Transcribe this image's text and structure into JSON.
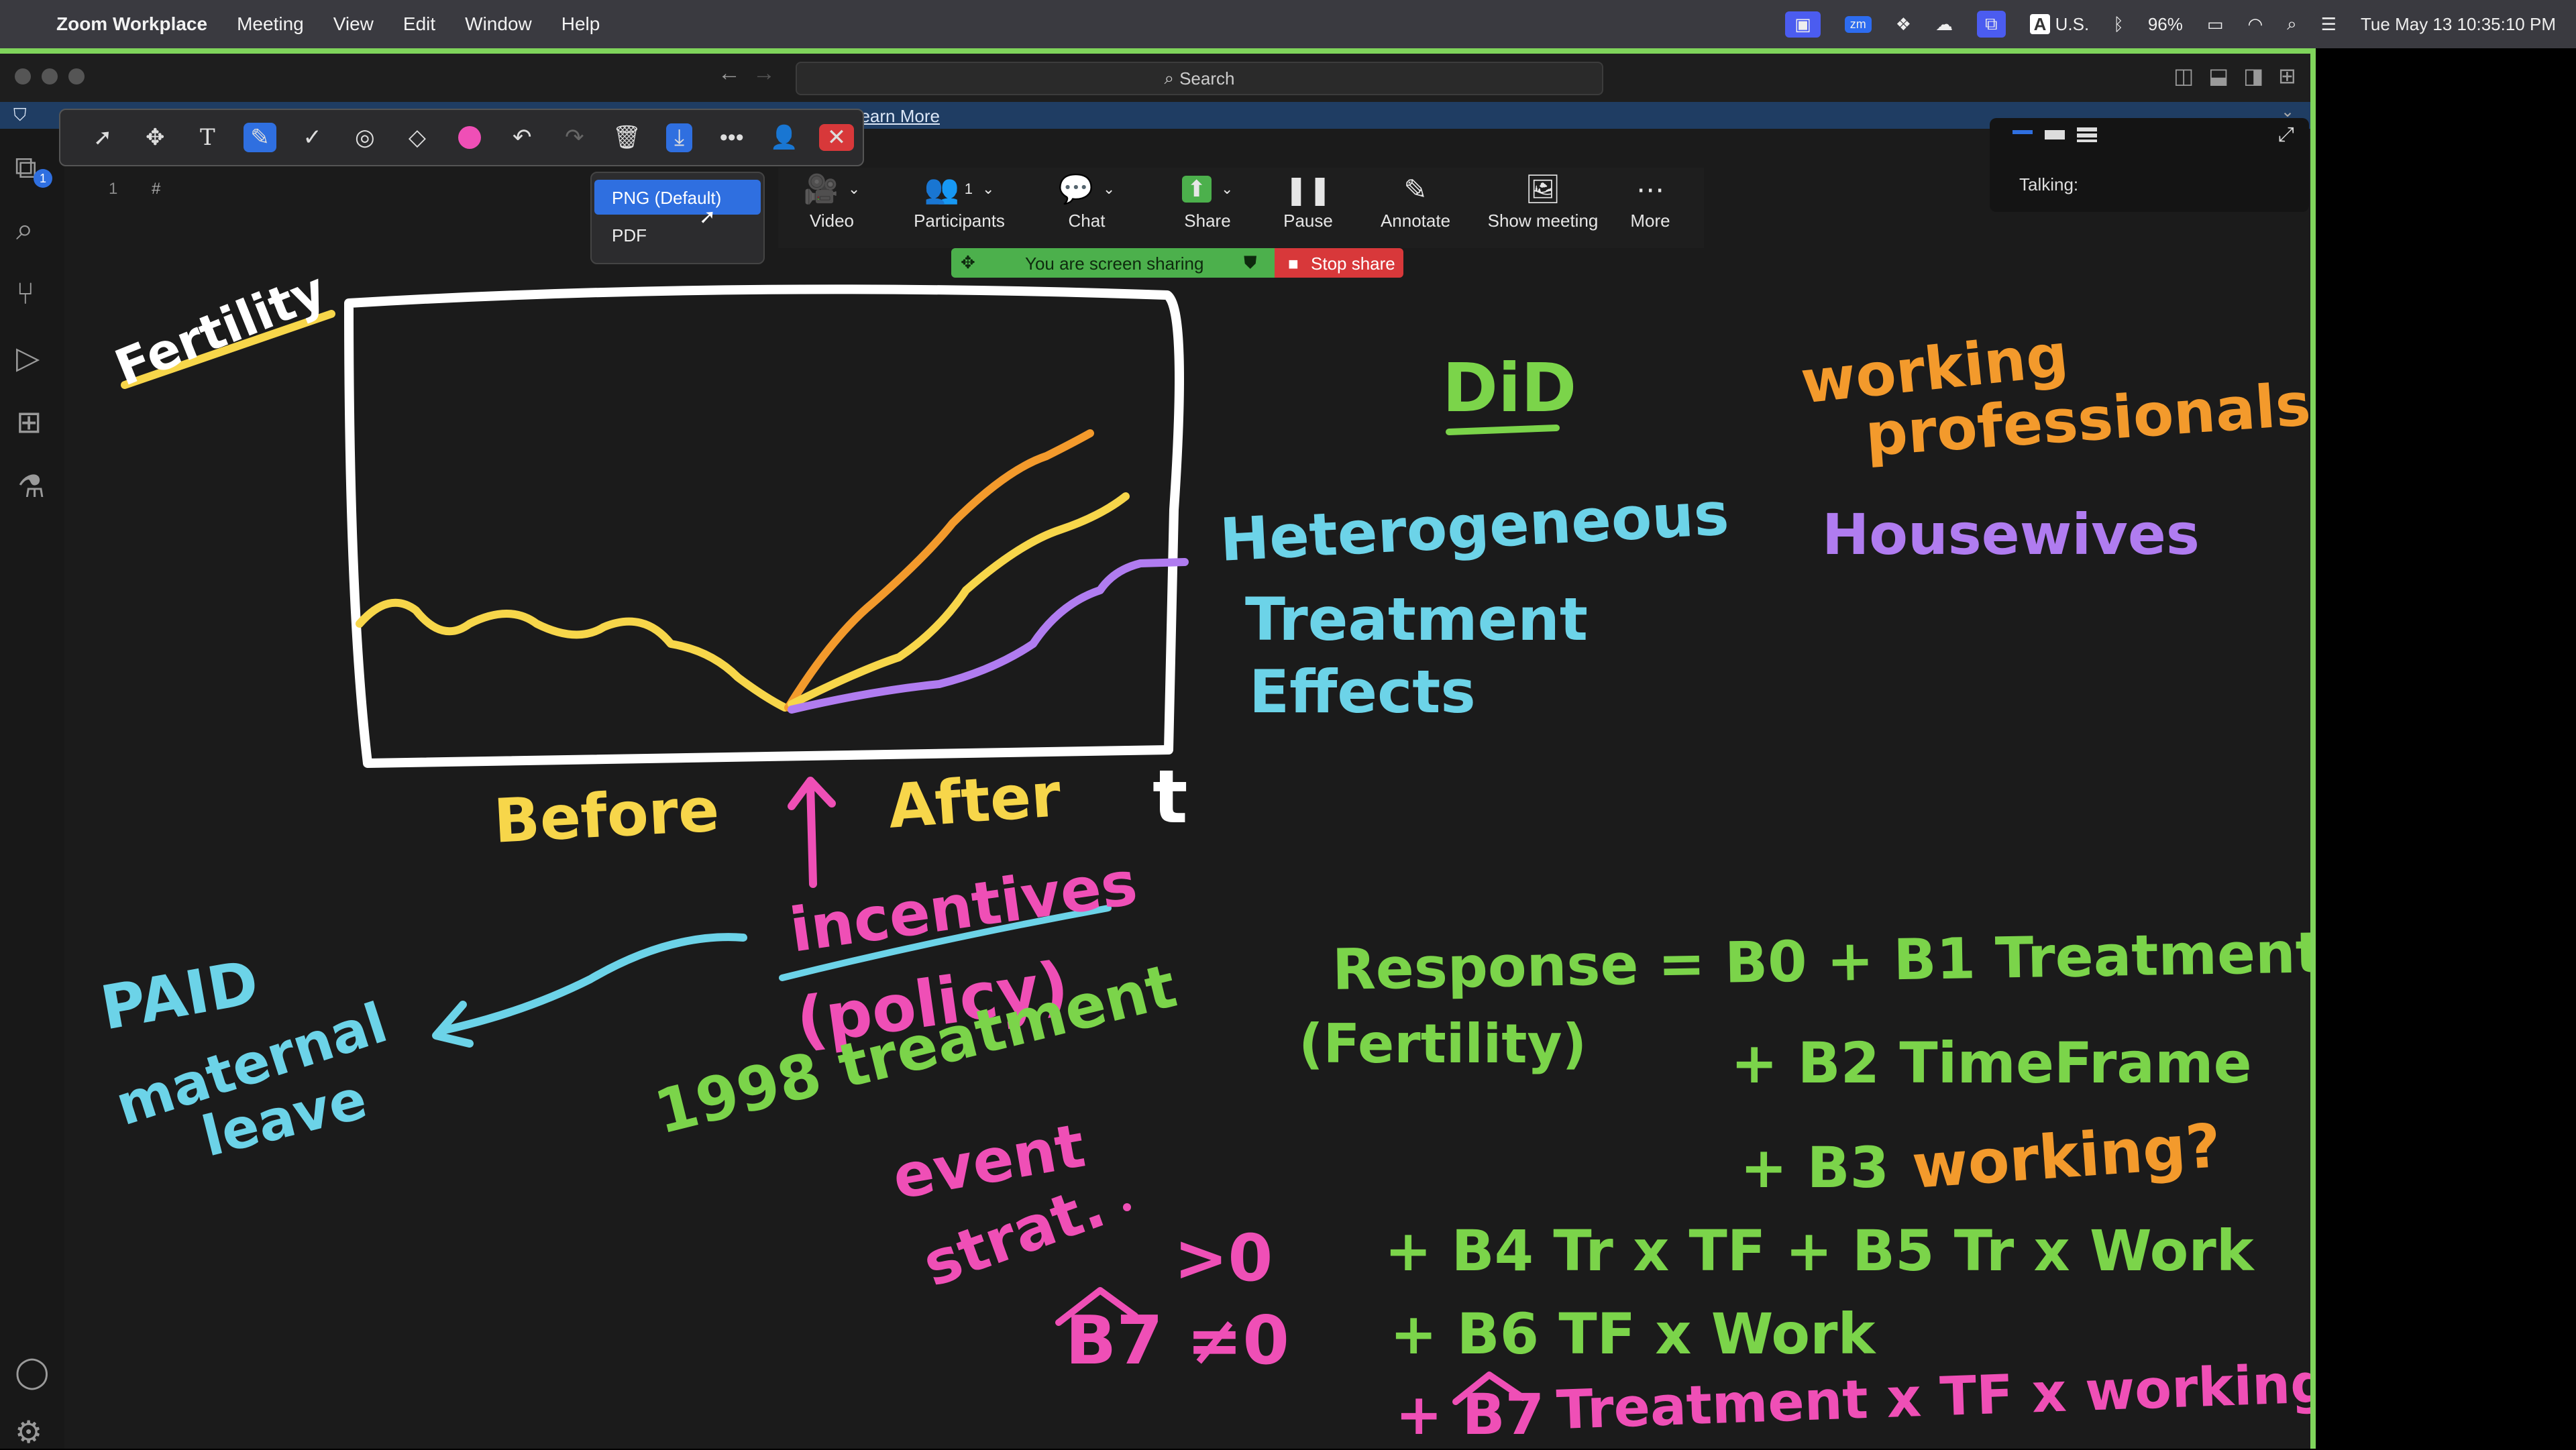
{
  "menubar": {
    "app": "Zoom Workplace",
    "items": [
      "Meeting",
      "View",
      "Edit",
      "Window",
      "Help"
    ],
    "battery": "96%",
    "input": "U.S.",
    "datetime": "Tue May 13  10:35:10 PM"
  },
  "editor": {
    "search_placeholder": "Search",
    "line_number": "1",
    "line_content": "#",
    "info_learn_more": "Learn More",
    "activity_badge": "1"
  },
  "export_menu": {
    "options": [
      "PNG (Default)",
      "PDF"
    ],
    "selected": "PNG (Default)"
  },
  "zoom_controls": {
    "video": "Video",
    "participants": "Participants",
    "participants_count": "1",
    "chat": "Chat",
    "share": "Share",
    "pause": "Pause",
    "annotate": "Annotate",
    "show_meeting": "Show meeting",
    "more": "More",
    "sharing_status": "You are screen sharing",
    "stop_share": "Stop share"
  },
  "talking_panel": {
    "label": "Talking:"
  },
  "whiteboard": {
    "fertility": "Fertility",
    "before": "Before",
    "after": "After",
    "t": "t",
    "did": "DiD",
    "heterogeneous": "Heterogeneous",
    "treatment": "Treatment",
    "effects": "Effects",
    "working": "working",
    "professionals": "professionals",
    "housewives": "Housewives",
    "incentives": "incentives",
    "policy": "(policy)",
    "paid": "PAID",
    "maternal": "maternal",
    "leave": "leave",
    "treatment_event": "1998 treatment",
    "event": "event",
    "strat": "strat.",
    "gt0": ">0",
    "neq0": "B7 ≠0",
    "eq_line1": "Response = B0 + B1 Treatment",
    "eq_fertility": "(Fertility)",
    "eq_line2": "+ B2 TimeFrame",
    "eq_line3a": "+ B3",
    "eq_line3b": "working?",
    "eq_line4": "+ B4 Tr x TF + B5  Tr x Work",
    "eq_line5": "+ B6  TF x Work",
    "eq_line6a": "+ B7",
    "eq_line6b": "Treatment x TF x working"
  },
  "colors": {
    "yellow": "#f7d64a",
    "orange": "#f39a2c",
    "purple": "#b07cf0",
    "cyan": "#6cd3e8",
    "green": "#7bd44a",
    "pink": "#ef4fb6",
    "accent_blue": "#2f6fe0",
    "share_green": "#4cb04c",
    "stop_red": "#d8383a"
  }
}
